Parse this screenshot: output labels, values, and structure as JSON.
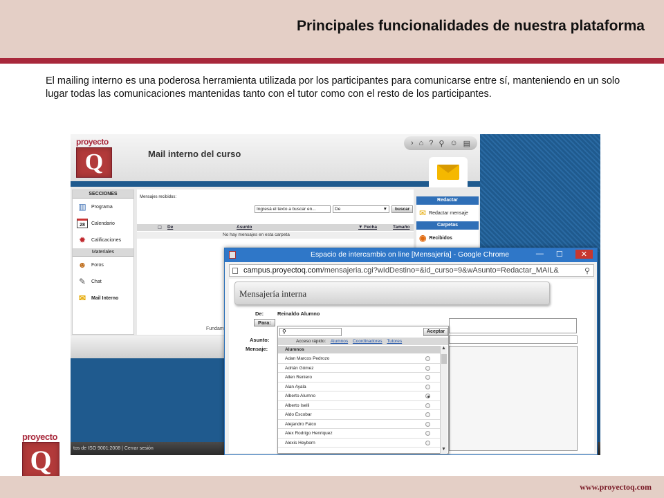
{
  "slide": {
    "title": "Principales funcionalidades de nuestra plataforma",
    "intro": "El mailing interno es una poderosa herramienta utilizada por los participantes para comunicarse entre sí, manteniendo en un solo lugar todas las comunicaciones mantenidas tanto con el tutor como con el resto de los participantes.",
    "footer_url": "www.proyectoq.com",
    "logo_word": "proyecto",
    "logo_letter": "Q"
  },
  "app": {
    "logo_word": "proyecto",
    "logo_letter": "Q",
    "title": "Mail interno del curso",
    "toolbar_icons": [
      "arrow-right-icon",
      "home-icon",
      "help-icon",
      "search-icon",
      "user-icon",
      "print-icon"
    ],
    "sidebar": {
      "header": "SECCIONES",
      "items": [
        {
          "label": "Programa",
          "icon": "books-icon"
        },
        {
          "label": "Calendario",
          "icon": "calendar-icon",
          "badge": "28"
        },
        {
          "label": "Calificaciones",
          "icon": "medal-icon"
        }
      ],
      "subheader": "Materiales",
      "items2": [
        {
          "label": "Foros",
          "icon": "forum-icon"
        },
        {
          "label": "Chat",
          "icon": "chat-icon"
        },
        {
          "label": "Mail Interno",
          "icon": "mail-icon"
        }
      ]
    },
    "main": {
      "received_label": "Mensajes recibidos:",
      "search_placeholder": "Ingresá el texto a buscar en...",
      "search_field_value": "De",
      "search_button": "buscar",
      "columns": {
        "de": "De",
        "asunto": "Asunto",
        "fecha": "▼ Fecha",
        "tamano": "Tamaño"
      },
      "empty": "No hay mensajes en esta carpeta"
    },
    "right_panel": {
      "header_redactar": "Redactar",
      "redactar_item": "Redactar mensaje",
      "header_carpetas": "Carpetas",
      "recibidos_item": "Recibidos"
    },
    "footer_partial": "Fundam",
    "bottom_bar": "tos de ISO 9001:2008  |  Cerrar sesión"
  },
  "popup": {
    "window_title": "Espacio de intercambio on line [Mensajería] - Google Chrome",
    "address_domain": "campus.proyectoq.com",
    "address_path": "/mensajeria.cgi?wIdDestino=&id_curso=9&wAsunto=Redactar_MAIL&",
    "heading": "Mensajería interna",
    "de_label": "De:",
    "de_value": "Reinaldo Alumno",
    "para_button": "Para:",
    "asunto_label": "Asunto:",
    "mensaje_label": "Mensaje:",
    "dropdown": {
      "accept_button": "Aceptar",
      "quick_access_label": "Acceso rápido:",
      "quick_links": [
        "Alumnos",
        "Coordinadores",
        "Tutores"
      ],
      "list_header": "Alumnos",
      "students": [
        {
          "name": "Adan Marcos Pedrozo",
          "selected": false
        },
        {
          "name": "Adrián Gómez",
          "selected": false
        },
        {
          "name": "Allen Reniero",
          "selected": false
        },
        {
          "name": "Alan Ayala",
          "selected": false
        },
        {
          "name": "Alberto Alumno",
          "selected": true
        },
        {
          "name": "Alberto Iselli",
          "selected": false
        },
        {
          "name": "Aldo Escobar",
          "selected": false
        },
        {
          "name": "Alejandro Falco",
          "selected": false
        },
        {
          "name": "Alex Rodrigo Henriquez",
          "selected": false
        },
        {
          "name": "Alexis Heyborn",
          "selected": false
        }
      ]
    }
  }
}
